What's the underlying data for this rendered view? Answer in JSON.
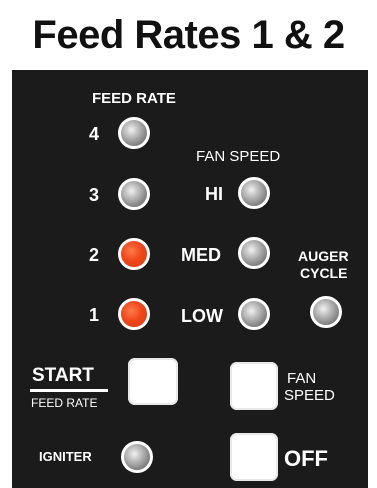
{
  "title": "Feed Rates 1 & 2",
  "labels": {
    "feed_rate": "FEED RATE",
    "fan_speed": "FAN SPEED",
    "auger_line1": "AUGER",
    "auger_line2": "CYCLE",
    "start": "START",
    "start_sub": "FEED RATE",
    "fan_speed_btn_line1": "FAN",
    "fan_speed_btn_line2": "SPEED",
    "igniter": "IGNITER",
    "off": "OFF"
  },
  "feed_rate_levels": [
    "4",
    "3",
    "2",
    "1"
  ],
  "fan_speed_levels": [
    "HI",
    "MED",
    "LOW"
  ],
  "indicators": {
    "feed_4": "off",
    "feed_3": "off",
    "feed_2": "on",
    "feed_1": "on",
    "fan_hi": "off",
    "fan_med": "off",
    "fan_low": "off",
    "auger_cycle": "off",
    "igniter": "off"
  },
  "colors": {
    "panel": "#1b1b1b",
    "led_on": "#f0471c",
    "led_off": "#a0a0a0"
  }
}
